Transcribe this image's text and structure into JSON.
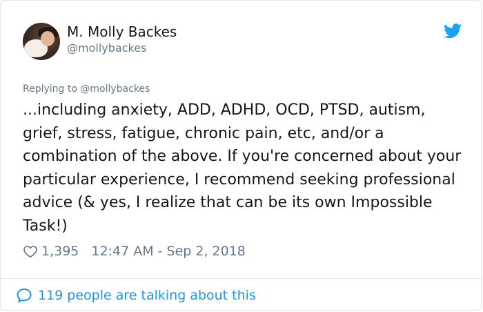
{
  "author": {
    "name": "M. Molly Backes",
    "handle": "@mollybackes"
  },
  "reply": {
    "prefix": "Replying to",
    "mention": "@mollybackes"
  },
  "tweet": {
    "text": "...including anxiety, ADD, ADHD, OCD, PTSD, autism, grief, stress, fatigue, chronic pain, etc, and/or a combination of the above. If you're concerned about your particular experience, I recommend seeking professional advice (& yes, I realize that can be its own Impossible Task!)"
  },
  "meta": {
    "likes": "1,395",
    "timestamp": "12:47 AM - Sep 2, 2018"
  },
  "footer": {
    "talking": "119 people are talking about this"
  },
  "icons": {
    "brand": "twitter-bird-icon",
    "like": "heart-icon",
    "conversation": "speech-bubble-icon"
  },
  "colors": {
    "text": "#14171a",
    "secondary": "#657786",
    "accent": "#1b95e0",
    "border": "#e1e8ed"
  }
}
